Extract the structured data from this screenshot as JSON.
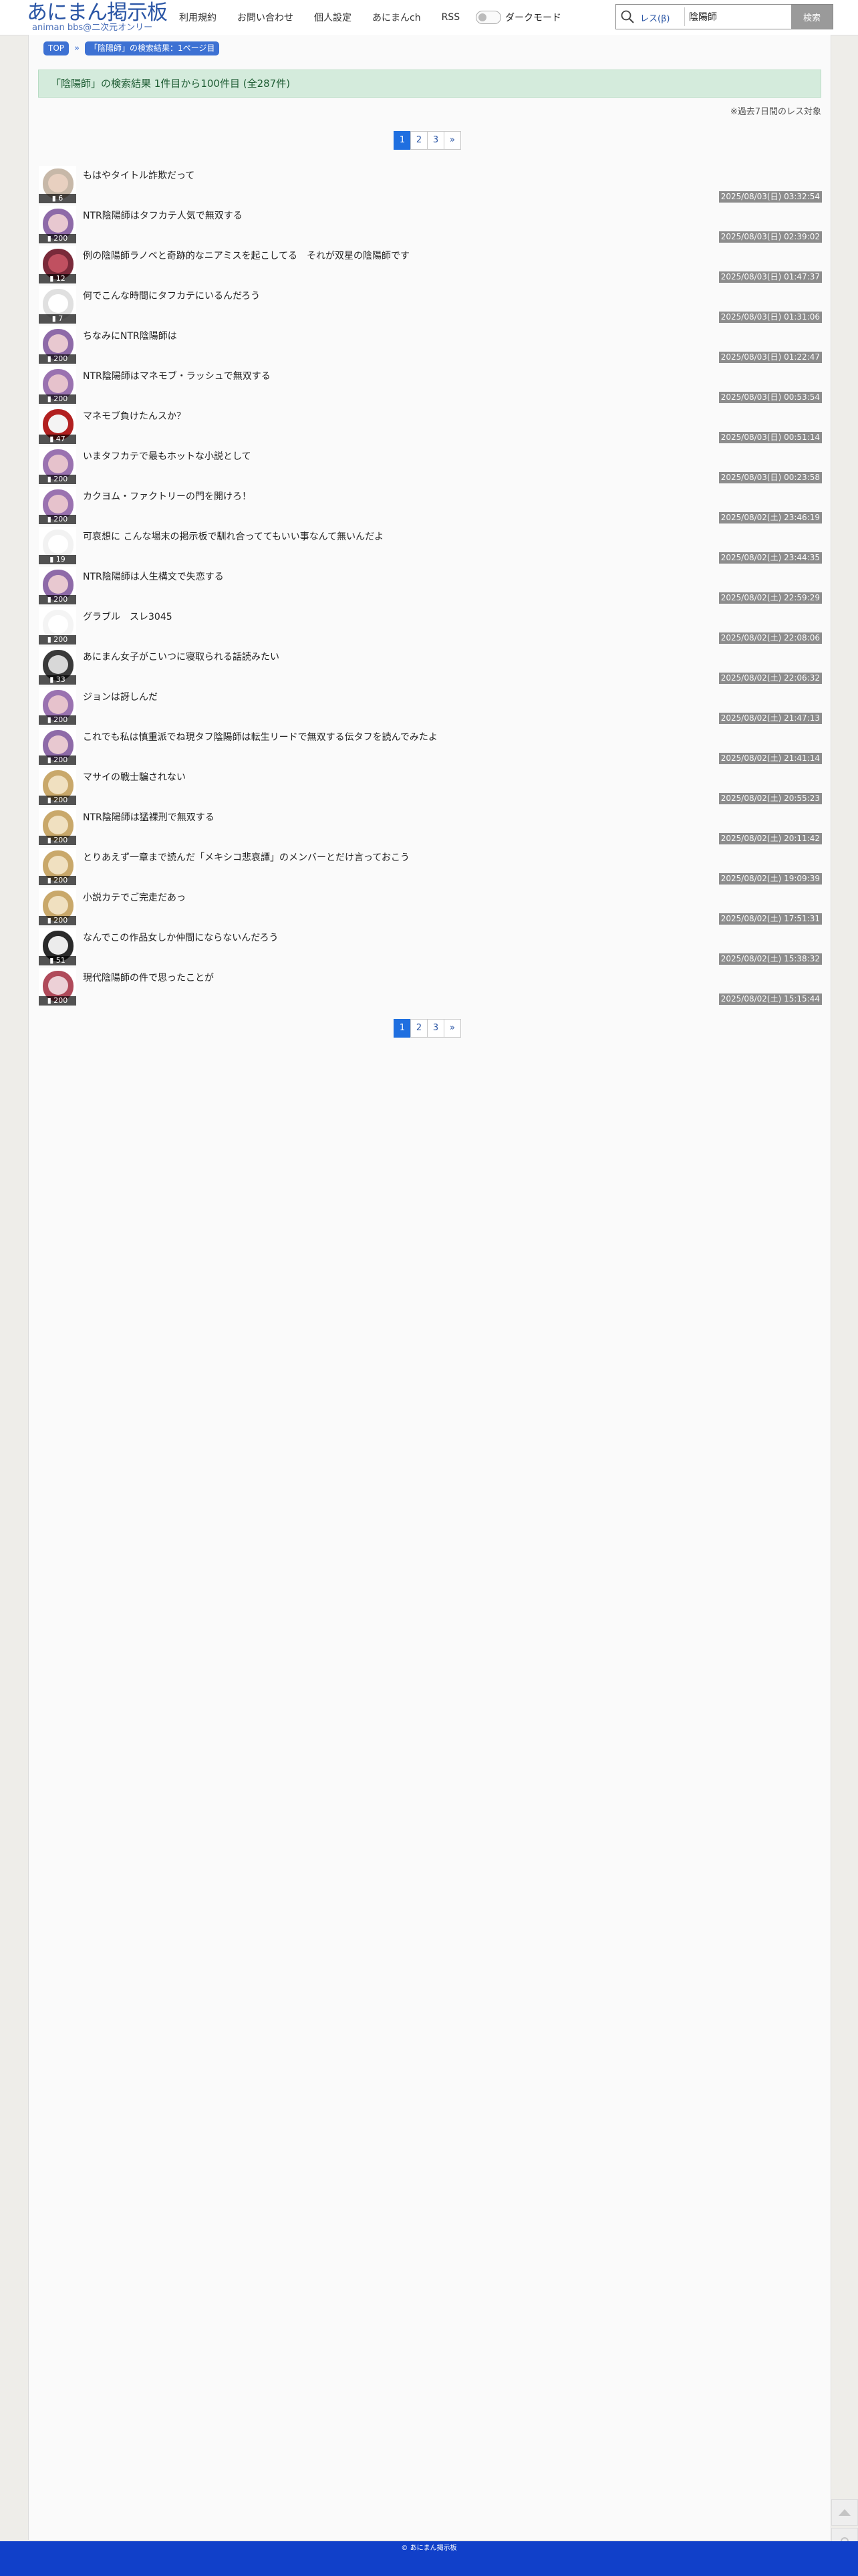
{
  "header": {
    "logo_title": "あにまん掲示板",
    "logo_subtitle": "animan bbs@二次元オンリー",
    "nav": [
      "利用規約",
      "お問い合わせ",
      "個人設定",
      "あにまんch",
      "RSS"
    ],
    "dark_mode_label": "ダークモード",
    "search": {
      "mode": "レス(β)",
      "value": "陰陽師",
      "button": "検索"
    }
  },
  "breadcrumb": {
    "top": "TOP",
    "current": "「陰陽師」の検索結果：1ページ目"
  },
  "result_summary": "「陰陽師」の検索結果 1件目から100件目 (全287件)",
  "notice": "※過去7日間のレス対象",
  "pagination": [
    "1",
    "2",
    "3",
    "»"
  ],
  "current_page": "1",
  "threads": [
    {
      "title": "もはやタイトル詐欺だって",
      "count": "6",
      "date": "2025/08/03(日) 03:32:54",
      "colors": [
        "#c7b8a8",
        "#e8d0c0"
      ]
    },
    {
      "title": "NTR陰陽師はタフカテ人気で無双する",
      "count": "200",
      "date": "2025/08/03(日) 02:39:02",
      "colors": [
        "#8e6aa8",
        "#e8c8d0"
      ]
    },
    {
      "title": "例の陰陽師ラノベと奇跡的なニアミスを起こしてる　それが双星の陰陽師です",
      "count": "12",
      "date": "2025/08/03(日) 01:47:37",
      "colors": [
        "#7a2a3a",
        "#c05060"
      ]
    },
    {
      "title": "何でこんな時間にタフカテにいるんだろう",
      "count": "7",
      "date": "2025/08/03(日) 01:31:06",
      "colors": [
        "#e0e0e0",
        "#ffffff"
      ]
    },
    {
      "title": "ちなみにNTR陰陽師は",
      "count": "200",
      "date": "2025/08/03(日) 01:22:47",
      "colors": [
        "#8e6aa8",
        "#e8c8d0"
      ]
    },
    {
      "title": "NTR陰陽師はマネモブ・ラッシュで無双する",
      "count": "200",
      "date": "2025/08/03(日) 00:53:54",
      "colors": [
        "#9a72b0",
        "#e6c2cc"
      ]
    },
    {
      "title": "マネモブ負けたんスか？",
      "count": "47",
      "date": "2025/08/03(日) 00:51:14",
      "colors": [
        "#b22020",
        "#f4f4f4"
      ]
    },
    {
      "title": "いまタフカテで最もホットな小説として",
      "count": "200",
      "date": "2025/08/03(日) 00:23:58",
      "colors": [
        "#9a72b0",
        "#e6c2cc"
      ]
    },
    {
      "title": "カクヨム・ファクトリーの門を開けろ！",
      "count": "200",
      "date": "2025/08/02(土) 23:46:19",
      "colors": [
        "#9a72b0",
        "#e6c2cc"
      ]
    },
    {
      "title": "可哀想に こんな場末の掲示板で馴れ合っててもいい事なんて無いんだよ",
      "count": "19",
      "date": "2025/08/02(土) 23:44:35",
      "colors": [
        "#f2f2f2",
        "#ffffff"
      ]
    },
    {
      "title": "NTR陰陽師は人生構文で失恋する",
      "count": "200",
      "date": "2025/08/02(土) 22:59:29",
      "colors": [
        "#8e6aa8",
        "#e8c8d0"
      ]
    },
    {
      "title": "グラブル　スレ3045",
      "count": "200",
      "date": "2025/08/02(土) 22:08:06",
      "colors": [
        "#f4f4f4",
        "#ffffff"
      ]
    },
    {
      "title": "あにまん女子がこいつに寝取られる話読みたい",
      "count": "33",
      "date": "2025/08/02(土) 22:06:32",
      "colors": [
        "#3a3a3a",
        "#d8d8d8"
      ]
    },
    {
      "title": "ジョンは訝しんだ",
      "count": "200",
      "date": "2025/08/02(土) 21:47:13",
      "colors": [
        "#9a72b0",
        "#e6c2cc"
      ]
    },
    {
      "title": "これでも私は慎重派でね現タフ陰陽師は転生リードで無双する伝タフを読んでみたよ",
      "count": "200",
      "date": "2025/08/02(土) 21:41:14",
      "colors": [
        "#8e6aa8",
        "#e8c8d0"
      ]
    },
    {
      "title": "マサイの戦士騙されない",
      "count": "200",
      "date": "2025/08/02(土) 20:55:23",
      "colors": [
        "#c9a86a",
        "#f0e0c0"
      ]
    },
    {
      "title": "NTR陰陽師は猛裸刑で無双する",
      "count": "200",
      "date": "2025/08/02(土) 20:11:42",
      "colors": [
        "#c9a86a",
        "#f0e0c0"
      ]
    },
    {
      "title": "とりあえず一章まで読んだ「メキシコ悲哀譚」のメンバーとだけ言っておこう",
      "count": "200",
      "date": "2025/08/02(土) 19:09:39",
      "colors": [
        "#c9a86a",
        "#f0e0c0"
      ]
    },
    {
      "title": "小説カテでご完走だあっ",
      "count": "200",
      "date": "2025/08/02(土) 17:51:31",
      "colors": [
        "#c9a86a",
        "#f0e0c0"
      ]
    },
    {
      "title": "なんでこの作品女しか仲間にならないんだろう",
      "count": "51",
      "date": "2025/08/02(土) 15:38:32",
      "colors": [
        "#2a2a2a",
        "#ececec"
      ]
    },
    {
      "title": "現代陰陽師の件で思ったことが",
      "count": "200",
      "date": "2025/08/02(土) 15:15:44",
      "colors": [
        "#b04a5a",
        "#ecd0d6"
      ]
    }
  ],
  "footer": "© あにまん掲示板"
}
